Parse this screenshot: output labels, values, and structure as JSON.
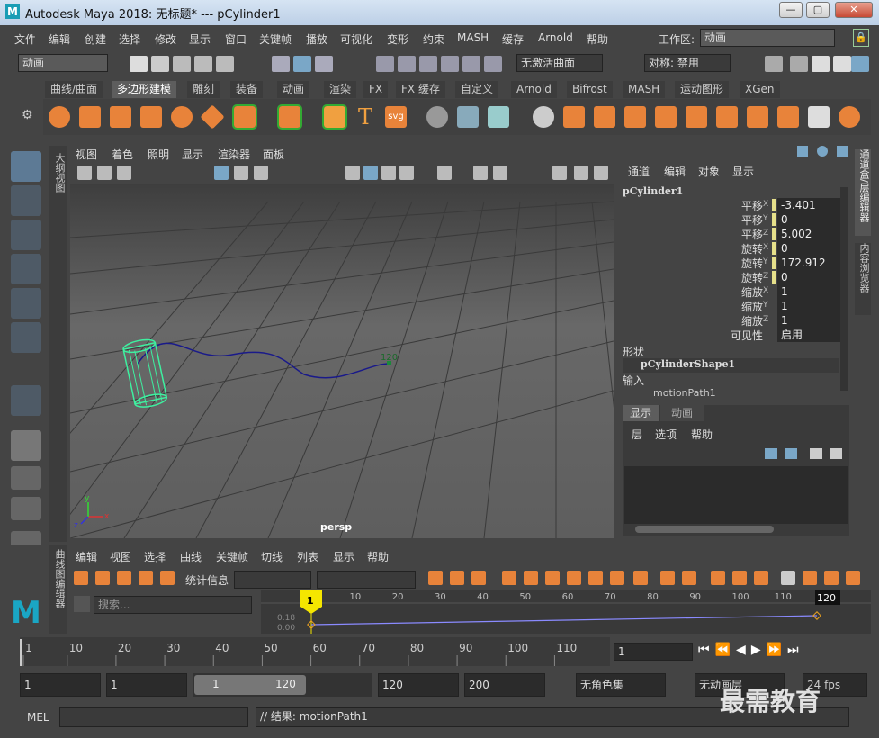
{
  "window": {
    "logo": "M",
    "title": "Autodesk Maya 2018: 无标题*   ---   pCylinder1",
    "min": "—",
    "max": "▢",
    "close": "✕"
  },
  "menubar": {
    "items": [
      "文件",
      "编辑",
      "创建",
      "选择",
      "修改",
      "显示",
      "窗口",
      "关键帧",
      "播放",
      "可视化",
      "变形",
      "约束",
      "MASH",
      "缓存",
      "Arnold",
      "帮助"
    ],
    "workspace_label": "工作区:",
    "workspace_value": "动画"
  },
  "status": {
    "mode": "动画",
    "live_surface": "无激活曲面",
    "symmetry": "对称: 禁用"
  },
  "shelf": {
    "tabs": [
      "曲线/曲面",
      "多边形建模",
      "雕刻",
      "装备",
      "动画",
      "渲染",
      "FX",
      "FX 缓存",
      "自定义",
      "Arnold",
      "Bifrost",
      "MASH",
      "运动图形",
      "XGen"
    ],
    "active_tab": "多边形建模",
    "text_icon": "T",
    "svg_icon": "svg"
  },
  "viewport": {
    "menu": [
      "视图",
      "着色",
      "照明",
      "显示",
      "渲染器",
      "面板"
    ],
    "camera": "persp",
    "frame_marker": "120",
    "outliner_tab": "大纲视图",
    "axis_x": "x",
    "axis_y": "y",
    "axis_z": "z"
  },
  "channel_box": {
    "menu": [
      "通道",
      "编辑",
      "对象",
      "显示"
    ],
    "object": "pCylinder1",
    "attributes": [
      {
        "label": "平移",
        "axis": "X",
        "value": "-3.401"
      },
      {
        "label": "平移",
        "axis": "Y",
        "value": "0"
      },
      {
        "label": "平移",
        "axis": "Z",
        "value": "5.002"
      },
      {
        "label": "旋转",
        "axis": "X",
        "value": "0"
      },
      {
        "label": "旋转",
        "axis": "Y",
        "value": "172.912"
      },
      {
        "label": "旋转",
        "axis": "Z",
        "value": "0"
      },
      {
        "label": "缩放",
        "axis": "X",
        "value": "1"
      },
      {
        "label": "缩放",
        "axis": "Y",
        "value": "1"
      },
      {
        "label": "缩放",
        "axis": "Z",
        "value": "1"
      },
      {
        "label": "可见性",
        "axis": "",
        "value": "启用"
      }
    ],
    "shapes_label": "形状",
    "shape_name": "pCylinderShape1",
    "inputs_label": "输入",
    "input_name": "motionPath1"
  },
  "side_tabs": [
    "通道盒/层编辑器",
    "内容浏览器"
  ],
  "layer_editor": {
    "tabs": [
      "显示",
      "动画"
    ],
    "menu": [
      "层",
      "选项",
      "帮助"
    ]
  },
  "graph_editor": {
    "side_label": "曲线图编辑器",
    "menu": [
      "编辑",
      "视图",
      "选择",
      "曲线",
      "关键帧",
      "切线",
      "列表",
      "显示",
      "帮助"
    ],
    "stats_label": "统计信息",
    "search_placeholder": "搜索...",
    "ruler": [
      "10",
      "20",
      "30",
      "40",
      "50",
      "60",
      "70",
      "80",
      "90",
      "100",
      "110"
    ],
    "key_start": "1",
    "key_end": "120",
    "y_labels": [
      "0.18",
      "0.00"
    ]
  },
  "timeline": {
    "ticks": [
      "1",
      "10",
      "20",
      "30",
      "40",
      "50",
      "60",
      "70",
      "80",
      "90",
      "100",
      "110"
    ],
    "current_frame": "1"
  },
  "range": {
    "start": "1",
    "playback_start": "1",
    "slider_start": "1",
    "slider_end": "120",
    "playback_end": "120",
    "end": "200",
    "character_set": "无角色集",
    "anim_layer": "无动画层",
    "fps": "24 fps"
  },
  "command": {
    "language": "MEL",
    "result": "// 结果: motionPath1"
  },
  "watermark": "最需教育"
}
